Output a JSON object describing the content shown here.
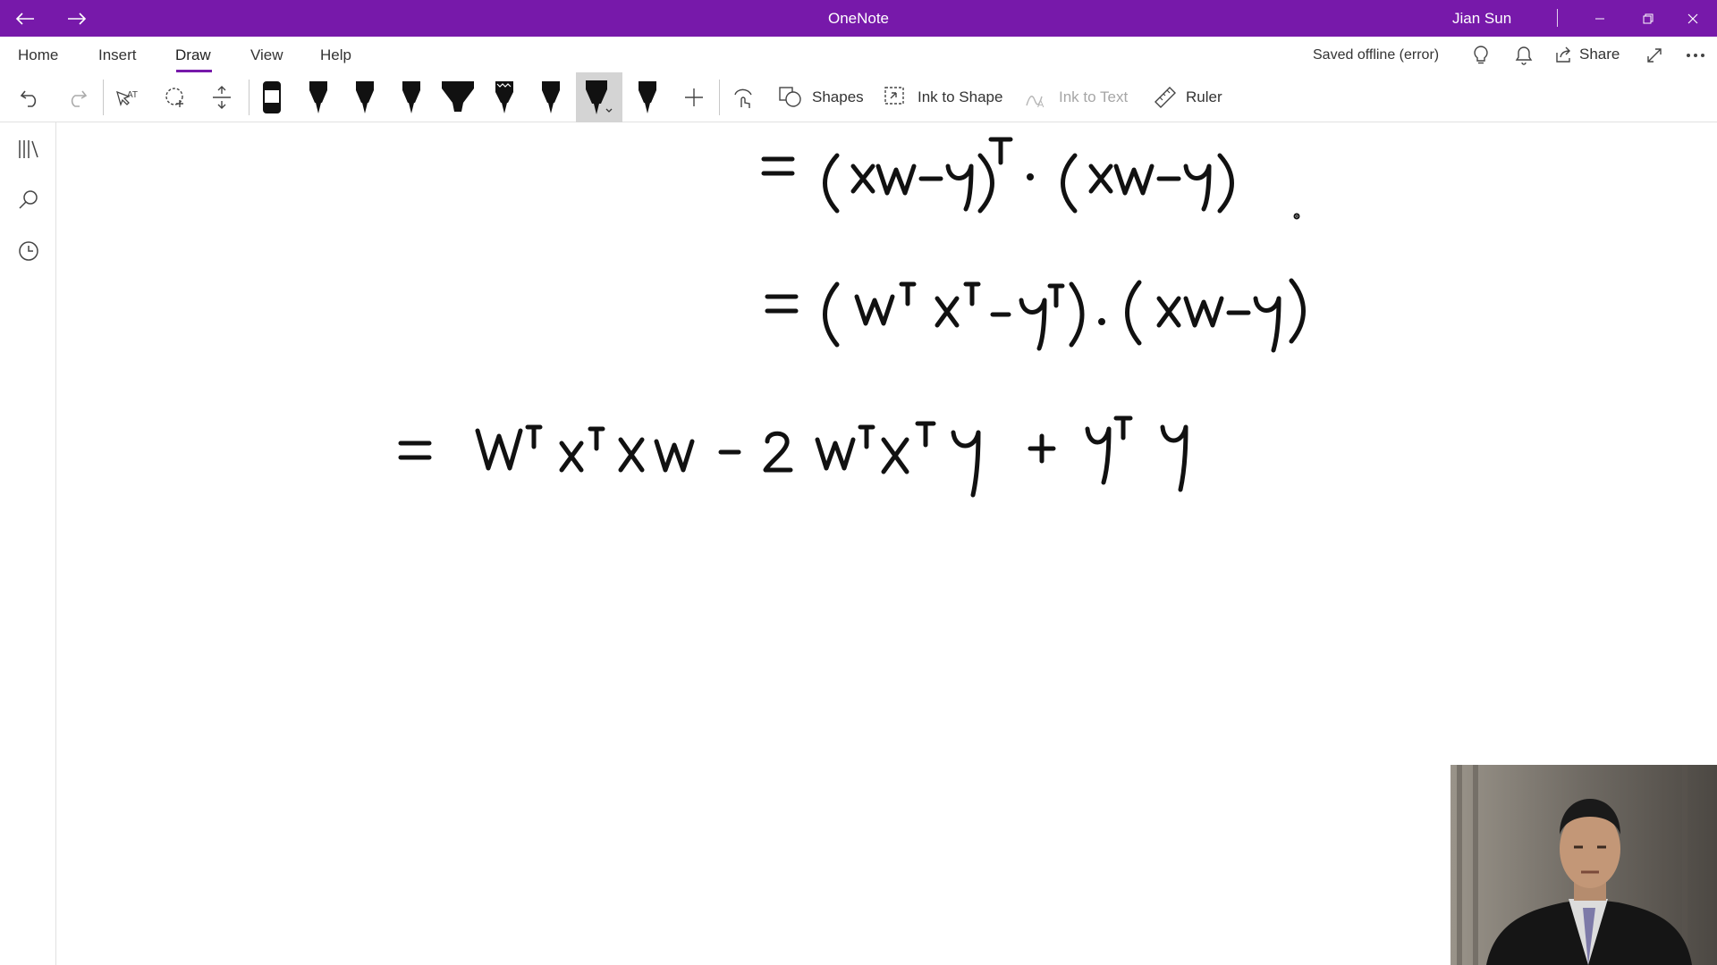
{
  "window": {
    "title": "OneNote",
    "user": "Jian Sun",
    "back_icon": "arrow-left-icon",
    "forward_icon": "arrow-right-icon"
  },
  "menu": {
    "tabs": [
      "Home",
      "Insert",
      "Draw",
      "View",
      "Help"
    ],
    "active_tab": "Draw",
    "status": "Saved offline (error)",
    "share_label": "Share"
  },
  "toolbar": {
    "shapes_label": "Shapes",
    "ink_to_shape_label": "Ink to Shape",
    "ink_to_text_label": "Ink to Text",
    "ruler_label": "Ruler"
  },
  "colors": {
    "accent": "#7719aa",
    "ink": "#111111"
  },
  "page": {
    "equations": [
      "= (xw − y)ᵀ · (xw − y)",
      "= (wᵀ xᵀ − yᵀ) · (xw − y)",
      "= wᵀ xᵀ x w − 2 wᵀ xᵀ y + yᵀ y"
    ]
  }
}
